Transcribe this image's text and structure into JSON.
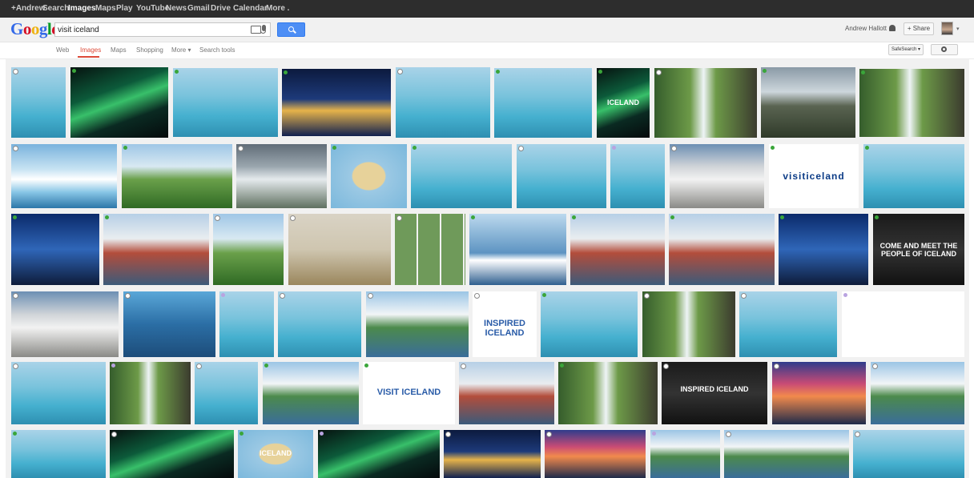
{
  "topbar": {
    "links": [
      "+Andrew",
      "Search",
      "Images",
      "Maps",
      "Play",
      "YouTube",
      "News",
      "Gmail",
      "Drive",
      "Calendar",
      "More ."
    ]
  },
  "header": {
    "logo": "Google",
    "query": "visit iceland",
    "user_name": "Andrew Hallott",
    "share_label": "+ Share",
    "avatar_caret": "▾"
  },
  "tabs": {
    "items": [
      "Web",
      "Images",
      "Maps",
      "Shopping",
      "More ▾",
      "Search tools"
    ],
    "active": "Images",
    "safesearch_label": "SafeSearch ▾"
  },
  "results": {
    "tile_captions": {
      "r1c7": "ICELAND",
      "r2c10": "visiticeland",
      "r3c10": "COME AND MEET THE\nPEOPLE OF ICELAND",
      "r4c6": "INSPIRED ICELAND",
      "r5c5": "VISIT ICELAND",
      "r5c8": "INSPIRED ICELAND",
      "r6c3": "ICELAND"
    },
    "colors": {
      "badge_green": "#3aa63a",
      "badge_white": "#ffffff",
      "badge_purple": "#b9a3e0"
    }
  }
}
